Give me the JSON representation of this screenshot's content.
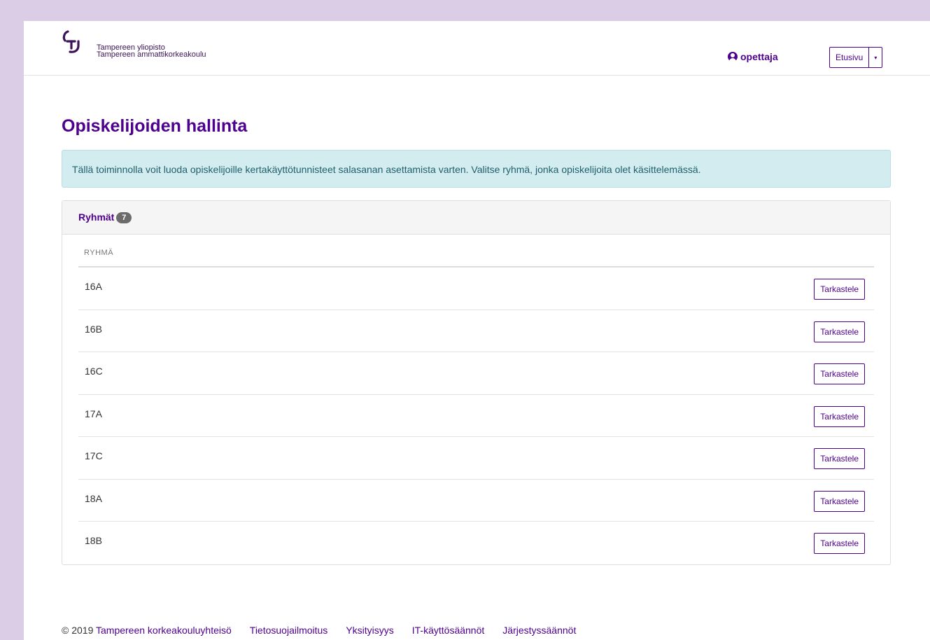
{
  "header": {
    "logo_line1": "Tampereen yliopisto",
    "logo_line2": "Tampereen ammattikorkeakoulu",
    "user_name": "opettaja",
    "nav_label": "Etusivu",
    "nav_caret": "▾"
  },
  "main": {
    "title": "Opiskelijoiden hallinta",
    "info": "Tällä toiminnolla voit luoda opiskelijoille kertakäyttötunnisteet salasanan asettamista varten. Valitse ryhmä, jonka opiskelijoita olet käsittelemässä.",
    "panel_title": "Ryhmät",
    "group_count": "7",
    "column_header": "RYHMÄ",
    "rows": [
      {
        "group": "16A",
        "action": "Tarkastele"
      },
      {
        "group": "16B",
        "action": "Tarkastele"
      },
      {
        "group": "16C",
        "action": "Tarkastele"
      },
      {
        "group": "17A",
        "action": "Tarkastele"
      },
      {
        "group": "17C",
        "action": "Tarkastele"
      },
      {
        "group": "18A",
        "action": "Tarkastele"
      },
      {
        "group": "18B",
        "action": "Tarkastele"
      }
    ]
  },
  "footer": {
    "copyright": "© 2019",
    "org_link": "Tampereen korkeakouluyhteisö",
    "links": [
      "Tietosuojailmoitus",
      "Yksityisyys",
      "IT-käyttösäännöt",
      "Järjestyssäännöt"
    ]
  },
  "colors": {
    "brand": "#4e008e",
    "background": "#dccde6",
    "info_bg": "#d2ecf0"
  },
  "icons": [
    "tuni-logo-icon",
    "user-circle-icon",
    "caret-down-icon"
  ]
}
